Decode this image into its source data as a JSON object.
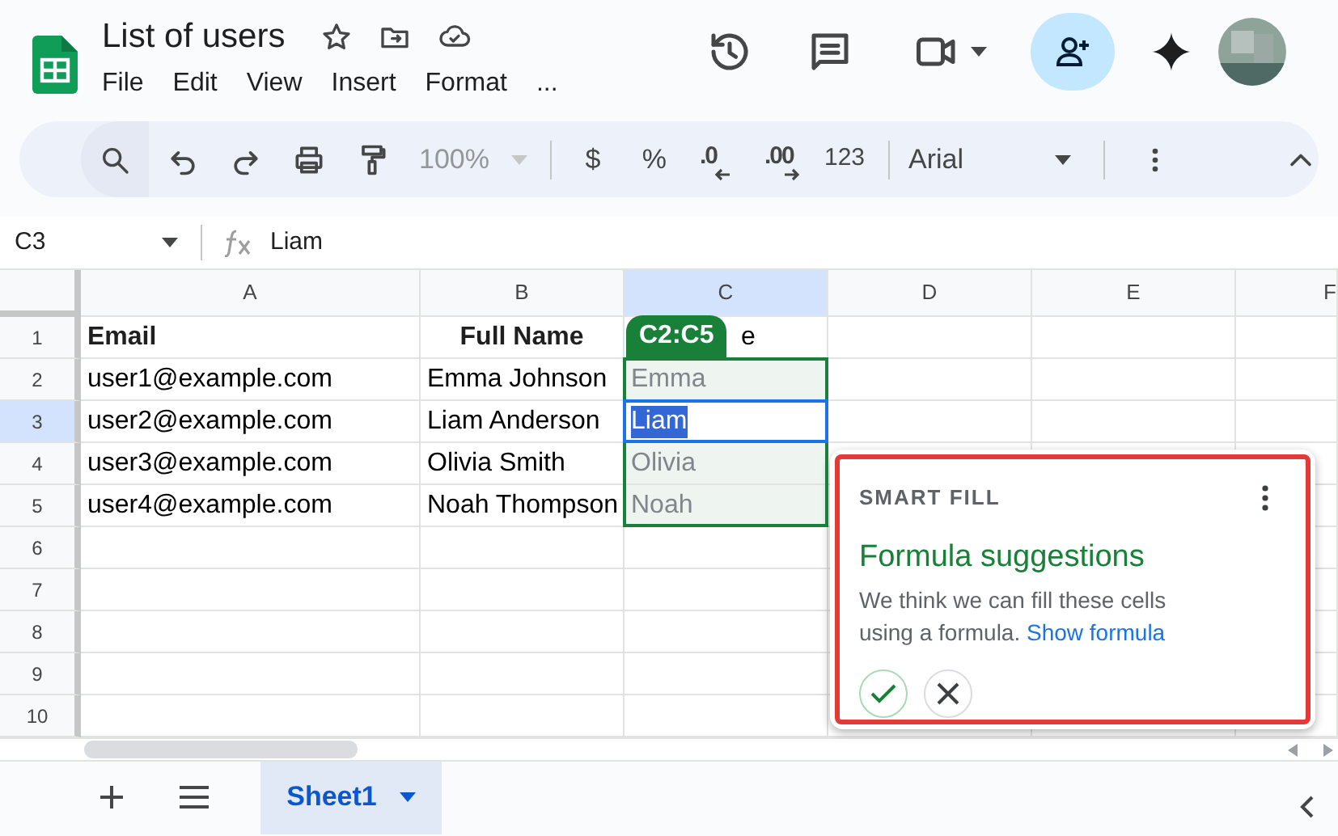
{
  "document": {
    "title": "List of users",
    "menu": [
      "File",
      "Edit",
      "View",
      "Insert",
      "Format",
      "..."
    ]
  },
  "toolbar": {
    "zoom": "100%",
    "currency": "$",
    "percent": "%",
    "decrease_decimals": ".0",
    "increase_decimals": ".00",
    "number_format": "123",
    "font": "Arial"
  },
  "formula_bar": {
    "name_box": "C3",
    "formula": "Liam"
  },
  "columns": [
    {
      "label": "A",
      "selected": false
    },
    {
      "label": "B",
      "selected": false
    },
    {
      "label": "C",
      "selected": true
    },
    {
      "label": "D",
      "selected": false
    },
    {
      "label": "E",
      "selected": false
    },
    {
      "label": "F",
      "selected": false
    }
  ],
  "rows": [
    {
      "number": "1",
      "selected": false,
      "cells": [
        {
          "text": "Email",
          "kind": "header"
        },
        {
          "text": "Full Name",
          "kind": "header"
        },
        {
          "text": "e",
          "kind": "covered"
        }
      ]
    },
    {
      "number": "2",
      "selected": false,
      "cells": [
        {
          "text": "user1@example.com",
          "kind": "plain"
        },
        {
          "text": "Emma Johnson",
          "kind": "plain"
        },
        {
          "text": "Emma",
          "kind": "suggested"
        }
      ]
    },
    {
      "number": "3",
      "selected": true,
      "cells": [
        {
          "text": "user2@example.com",
          "kind": "plain"
        },
        {
          "text": "Liam Anderson",
          "kind": "plain"
        },
        {
          "text": "Liam",
          "kind": "active"
        }
      ]
    },
    {
      "number": "4",
      "selected": false,
      "cells": [
        {
          "text": "user3@example.com",
          "kind": "plain"
        },
        {
          "text": "Olivia Smith",
          "kind": "plain"
        },
        {
          "text": "Olivia",
          "kind": "suggested"
        }
      ]
    },
    {
      "number": "5",
      "selected": false,
      "cells": [
        {
          "text": "user4@example.com",
          "kind": "plain"
        },
        {
          "text": "Noah Thompson",
          "kind": "plain"
        },
        {
          "text": "Noah",
          "kind": "suggested"
        }
      ]
    },
    {
      "number": "6",
      "selected": false,
      "cells": []
    },
    {
      "number": "7",
      "selected": false,
      "cells": []
    },
    {
      "number": "8",
      "selected": false,
      "cells": []
    },
    {
      "number": "9",
      "selected": false,
      "cells": []
    },
    {
      "number": "10",
      "selected": false,
      "cells": []
    }
  ],
  "range_badge": "C2:C5",
  "smart_fill": {
    "label": "SMART FILL",
    "title": "Formula suggestions",
    "message": "We think we can fill these cells using a formula.",
    "link": "Show formula"
  },
  "sheet_tabs": [
    {
      "label": "Sheet1",
      "selected": true
    }
  ]
}
